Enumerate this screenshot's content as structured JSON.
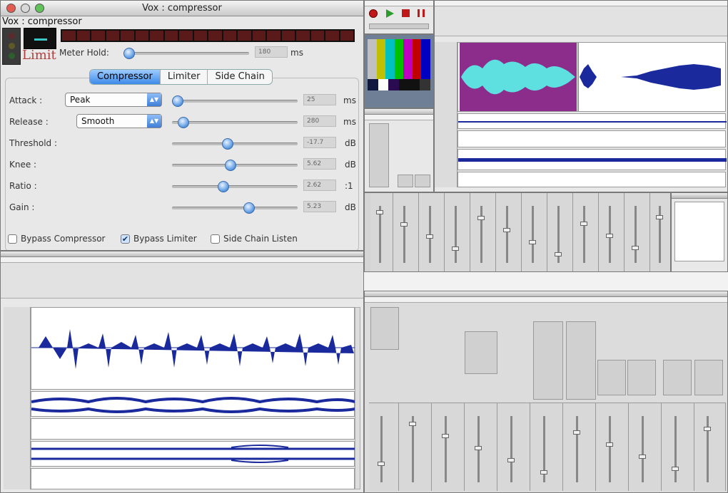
{
  "compressor": {
    "window_title": "Vox : compressor",
    "name": "Vox : compressor",
    "limit_label": "Limit",
    "meter_hold_label": "Meter Hold:",
    "meter_hold_value": "180",
    "meter_hold_unit": "ms",
    "meter_hold_level": 0.0,
    "tabs": [
      "Compressor",
      "Limiter",
      "Side Chain"
    ],
    "active_tab": "Compressor",
    "params": [
      {
        "label": "Attack :",
        "value": "25",
        "unit": "ms",
        "level": 0.02,
        "mode": "Peak"
      },
      {
        "label": "Release :",
        "value": "280",
        "unit": "ms",
        "level": 0.08,
        "mode": "Smooth"
      },
      {
        "label": "Threshold :",
        "value": "-17.7",
        "unit": "dB",
        "level": 0.44
      },
      {
        "label": "Knee :",
        "value": "5.62",
        "unit": "dB",
        "level": 0.46
      },
      {
        "label": "Ratio :",
        "value": "2.62",
        "unit": ":1",
        "level": 0.4
      },
      {
        "label": "Gain :",
        "value": "5.23",
        "unit": "dB",
        "level": 0.6
      }
    ],
    "checkboxes": [
      {
        "label": "Bypass Compressor",
        "checked": false
      },
      {
        "label": "Bypass Limiter",
        "checked": true
      },
      {
        "label": "Side Chain Listen",
        "checked": false
      }
    ]
  },
  "colors": {
    "knob_blue": "#3d8ae8",
    "wave_blue": "#1a2a9c",
    "wave_cyan": "#5fe0e0",
    "selection_purple": "#8c2d8c",
    "limit_red": "#b04040"
  }
}
